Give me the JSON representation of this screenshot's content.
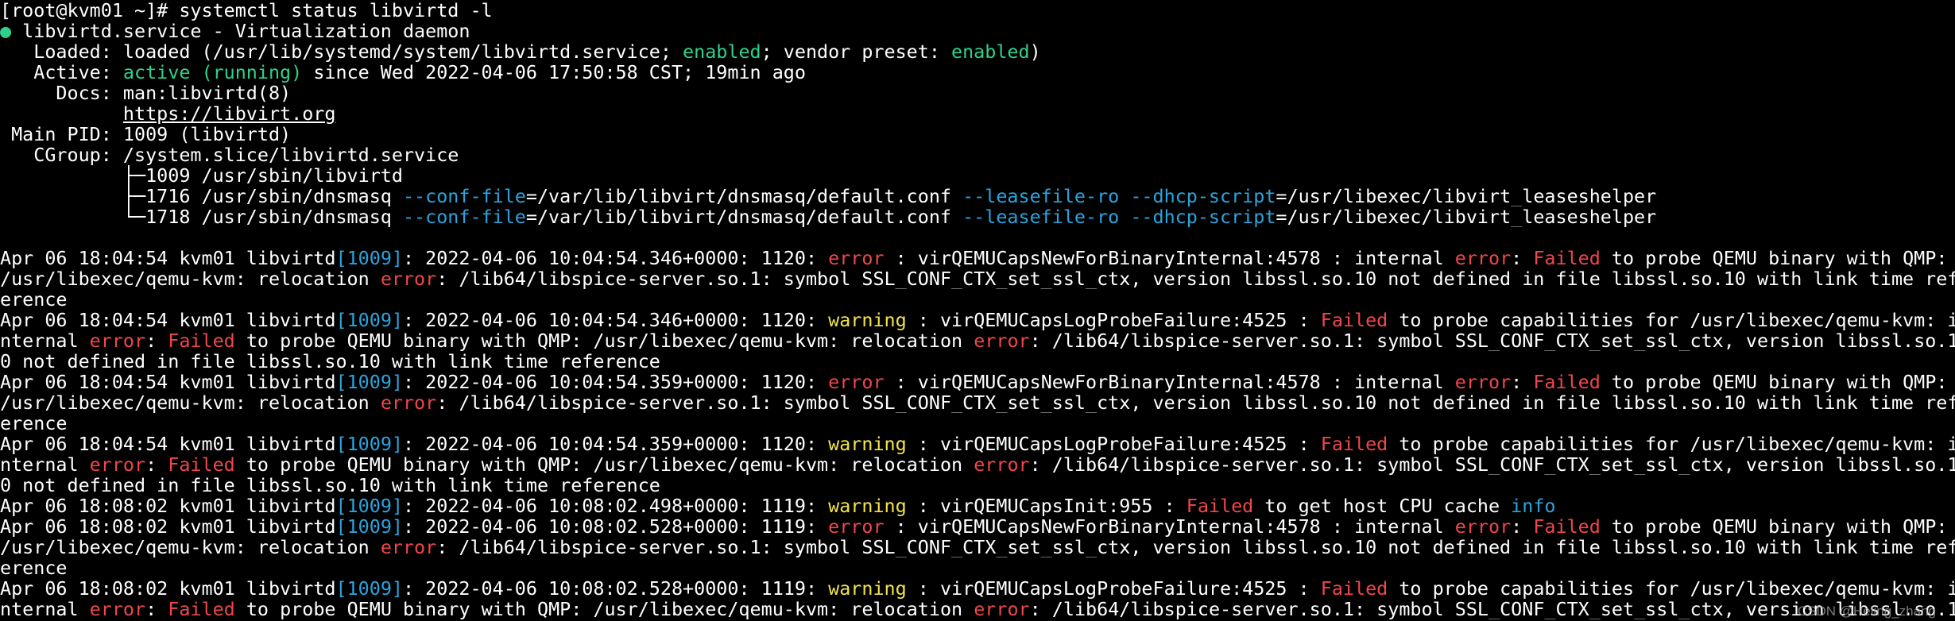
{
  "terminal": {
    "colors": {
      "background": "#000000",
      "text": "#ffffff",
      "green": "#2fd18a",
      "red": "#f0464b",
      "yellow": "#f2e34b",
      "blue": "#2aa4de"
    },
    "lines": [
      [
        [
          "white",
          "[root@kvm01 ~]# systemctl status libvirtd -l"
        ]
      ],
      [
        [
          "green",
          "● "
        ],
        [
          "white",
          "libvirtd.service - Virtualization daemon"
        ]
      ],
      [
        [
          "white",
          "   Loaded: loaded (/usr/lib/systemd/system/libvirtd.service; "
        ],
        [
          "green",
          "enabled"
        ],
        [
          "white",
          "; vendor preset: "
        ],
        [
          "green",
          "enabled"
        ],
        [
          "white",
          ")"
        ]
      ],
      [
        [
          "white",
          "   Active: "
        ],
        [
          "green",
          "active (running)"
        ],
        [
          "white",
          " since Wed 2022-04-06 17:50:58 CST; 19min ago"
        ]
      ],
      [
        [
          "white",
          "     Docs: man:libvirtd(8)"
        ]
      ],
      [
        [
          "white",
          "           "
        ],
        [
          "link",
          "https://libvirt.org"
        ]
      ],
      [
        [
          "white",
          " Main PID: 1009 (libvirtd)"
        ]
      ],
      [
        [
          "white",
          "   CGroup: /system.slice/libvirtd.service"
        ]
      ],
      [
        [
          "white",
          "           ├─1009 /usr/sbin/libvirtd"
        ]
      ],
      [
        [
          "white",
          "           ├─1716 /usr/sbin/dnsmasq "
        ],
        [
          "blue",
          "--conf-file"
        ],
        [
          "white",
          "=/var/lib/libvirt/dnsmasq/default.conf "
        ],
        [
          "blue",
          "--leasefile-ro"
        ],
        [
          "white",
          " "
        ],
        [
          "blue",
          "--dhcp-script"
        ],
        [
          "white",
          "=/usr/libexec/libvirt_leaseshelper"
        ]
      ],
      [
        [
          "white",
          "           └─1718 /usr/sbin/dnsmasq "
        ],
        [
          "blue",
          "--conf-file"
        ],
        [
          "white",
          "=/var/lib/libvirt/dnsmasq/default.conf "
        ],
        [
          "blue",
          "--leasefile-ro"
        ],
        [
          "white",
          " "
        ],
        [
          "blue",
          "--dhcp-script"
        ],
        [
          "white",
          "=/usr/libexec/libvirt_leaseshelper"
        ]
      ],
      [
        [
          "white",
          " "
        ]
      ],
      [
        [
          "white",
          "Apr 06 18:04:54 kvm01 libvirtd"
        ],
        [
          "blue",
          "[1009]"
        ],
        [
          "white",
          ": 2022-04-06 10:04:54.346+0000: 1120: "
        ],
        [
          "red",
          "error"
        ],
        [
          "white",
          " : virQEMUCapsNewForBinaryInternal:4578 : internal "
        ],
        [
          "red",
          "error"
        ],
        [
          "white",
          ": "
        ],
        [
          "red",
          "Failed"
        ],
        [
          "white",
          " to probe QEMU binary with QMP:"
        ]
      ],
      [
        [
          "white",
          "/usr/libexec/qemu-kvm: relocation "
        ],
        [
          "red",
          "error"
        ],
        [
          "white",
          ": /lib64/libspice-server.so.1: symbol SSL_CONF_CTX_set_ssl_ctx, version libssl.so.10 not defined in file libssl.so.10 with link time ref"
        ]
      ],
      [
        [
          "white",
          "erence"
        ]
      ],
      [
        [
          "white",
          "Apr 06 18:04:54 kvm01 libvirtd"
        ],
        [
          "blue",
          "[1009]"
        ],
        [
          "white",
          ": 2022-04-06 10:04:54.346+0000: 1120: "
        ],
        [
          "yellow",
          "warning"
        ],
        [
          "white",
          " : virQEMUCapsLogProbeFailure:4525 : "
        ],
        [
          "red",
          "Failed"
        ],
        [
          "white",
          " to probe capabilities for /usr/libexec/qemu-kvm: i"
        ]
      ],
      [
        [
          "white",
          "nternal "
        ],
        [
          "red",
          "error"
        ],
        [
          "white",
          ": "
        ],
        [
          "red",
          "Failed"
        ],
        [
          "white",
          " to probe QEMU binary with QMP: /usr/libexec/qemu-kvm: relocation "
        ],
        [
          "red",
          "error"
        ],
        [
          "white",
          ": /lib64/libspice-server.so.1: symbol SSL_CONF_CTX_set_ssl_ctx, version libssl.so.1"
        ]
      ],
      [
        [
          "white",
          "0 not defined in file libssl.so.10 with link time reference"
        ]
      ],
      [
        [
          "white",
          "Apr 06 18:04:54 kvm01 libvirtd"
        ],
        [
          "blue",
          "[1009]"
        ],
        [
          "white",
          ": 2022-04-06 10:04:54.359+0000: 1120: "
        ],
        [
          "red",
          "error"
        ],
        [
          "white",
          " : virQEMUCapsNewForBinaryInternal:4578 : internal "
        ],
        [
          "red",
          "error"
        ],
        [
          "white",
          ": "
        ],
        [
          "red",
          "Failed"
        ],
        [
          "white",
          " to probe QEMU binary with QMP:"
        ]
      ],
      [
        [
          "white",
          "/usr/libexec/qemu-kvm: relocation "
        ],
        [
          "red",
          "error"
        ],
        [
          "white",
          ": /lib64/libspice-server.so.1: symbol SSL_CONF_CTX_set_ssl_ctx, version libssl.so.10 not defined in file libssl.so.10 with link time ref"
        ]
      ],
      [
        [
          "white",
          "erence"
        ]
      ],
      [
        [
          "white",
          "Apr 06 18:04:54 kvm01 libvirtd"
        ],
        [
          "blue",
          "[1009]"
        ],
        [
          "white",
          ": 2022-04-06 10:04:54.359+0000: 1120: "
        ],
        [
          "yellow",
          "warning"
        ],
        [
          "white",
          " : virQEMUCapsLogProbeFailure:4525 : "
        ],
        [
          "red",
          "Failed"
        ],
        [
          "white",
          " to probe capabilities for /usr/libexec/qemu-kvm: i"
        ]
      ],
      [
        [
          "white",
          "nternal "
        ],
        [
          "red",
          "error"
        ],
        [
          "white",
          ": "
        ],
        [
          "red",
          "Failed"
        ],
        [
          "white",
          " to probe QEMU binary with QMP: /usr/libexec/qemu-kvm: relocation "
        ],
        [
          "red",
          "error"
        ],
        [
          "white",
          ": /lib64/libspice-server.so.1: symbol SSL_CONF_CTX_set_ssl_ctx, version libssl.so.1"
        ]
      ],
      [
        [
          "white",
          "0 not defined in file libssl.so.10 with link time reference"
        ]
      ],
      [
        [
          "white",
          "Apr 06 18:08:02 kvm01 libvirtd"
        ],
        [
          "blue",
          "[1009]"
        ],
        [
          "white",
          ": 2022-04-06 10:08:02.498+0000: 1119: "
        ],
        [
          "yellow",
          "warning"
        ],
        [
          "white",
          " : virQEMUCapsInit:955 : "
        ],
        [
          "red",
          "Failed"
        ],
        [
          "white",
          " to get host CPU cache "
        ],
        [
          "blue",
          "info"
        ]
      ],
      [
        [
          "white",
          "Apr 06 18:08:02 kvm01 libvirtd"
        ],
        [
          "blue",
          "[1009]"
        ],
        [
          "white",
          ": 2022-04-06 10:08:02.528+0000: 1119: "
        ],
        [
          "red",
          "error"
        ],
        [
          "white",
          " : virQEMUCapsNewForBinaryInternal:4578 : internal "
        ],
        [
          "red",
          "error"
        ],
        [
          "white",
          ": "
        ],
        [
          "red",
          "Failed"
        ],
        [
          "white",
          " to probe QEMU binary with QMP:"
        ]
      ],
      [
        [
          "white",
          "/usr/libexec/qemu-kvm: relocation "
        ],
        [
          "red",
          "error"
        ],
        [
          "white",
          ": /lib64/libspice-server.so.1: symbol SSL_CONF_CTX_set_ssl_ctx, version libssl.so.10 not defined in file libssl.so.10 with link time ref"
        ]
      ],
      [
        [
          "white",
          "erence"
        ]
      ],
      [
        [
          "white",
          "Apr 06 18:08:02 kvm01 libvirtd"
        ],
        [
          "blue",
          "[1009]"
        ],
        [
          "white",
          ": 2022-04-06 10:08:02.528+0000: 1119: "
        ],
        [
          "yellow",
          "warning"
        ],
        [
          "white",
          " : virQEMUCapsLogProbeFailure:4525 : "
        ],
        [
          "red",
          "Failed"
        ],
        [
          "white",
          " to probe capabilities for /usr/libexec/qemu-kvm: i"
        ]
      ],
      [
        [
          "white",
          "nternal "
        ],
        [
          "red",
          "error"
        ],
        [
          "white",
          ": "
        ],
        [
          "red",
          "Failed"
        ],
        [
          "white",
          " to probe QEMU binary with QMP: /usr/libexec/qemu-kvm: relocation "
        ],
        [
          "red",
          "error"
        ],
        [
          "white",
          ": /lib64/libspice-server.so.1: symbol SSL_CONF_CTX_set_ssl_ctx, version libssl.so.1"
        ]
      ]
    ]
  },
  "watermark": {
    "text": "CSDN @Heling_zhang"
  }
}
